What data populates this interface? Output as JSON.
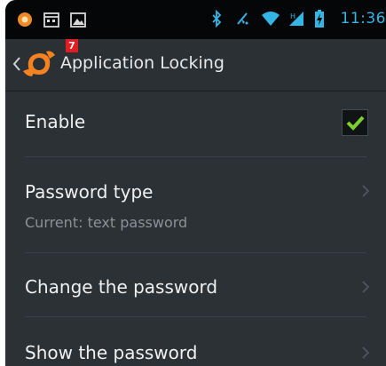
{
  "status_bar": {
    "time": "11:36",
    "left_icons": [
      "notification-dot-icon",
      "calendar-icon",
      "image-icon"
    ],
    "right_icons": [
      "bluetooth-icon",
      "mute-icon",
      "wifi-icon",
      "signal-icon",
      "battery-icon"
    ]
  },
  "action_bar": {
    "title": "Application Locking",
    "badge": "7"
  },
  "settings": [
    {
      "title": "Enable",
      "control": "checkbox",
      "checked": true
    },
    {
      "title": "Password type",
      "summary": "Current: text password",
      "control": "chevron"
    },
    {
      "title": "Change the password",
      "control": "chevron"
    },
    {
      "title": "Show the password",
      "control": "chevron"
    }
  ],
  "colors": {
    "accent": "#33b5e5",
    "check": "#7dd12f",
    "background": "#2b3135",
    "status_bar": "#050607"
  }
}
